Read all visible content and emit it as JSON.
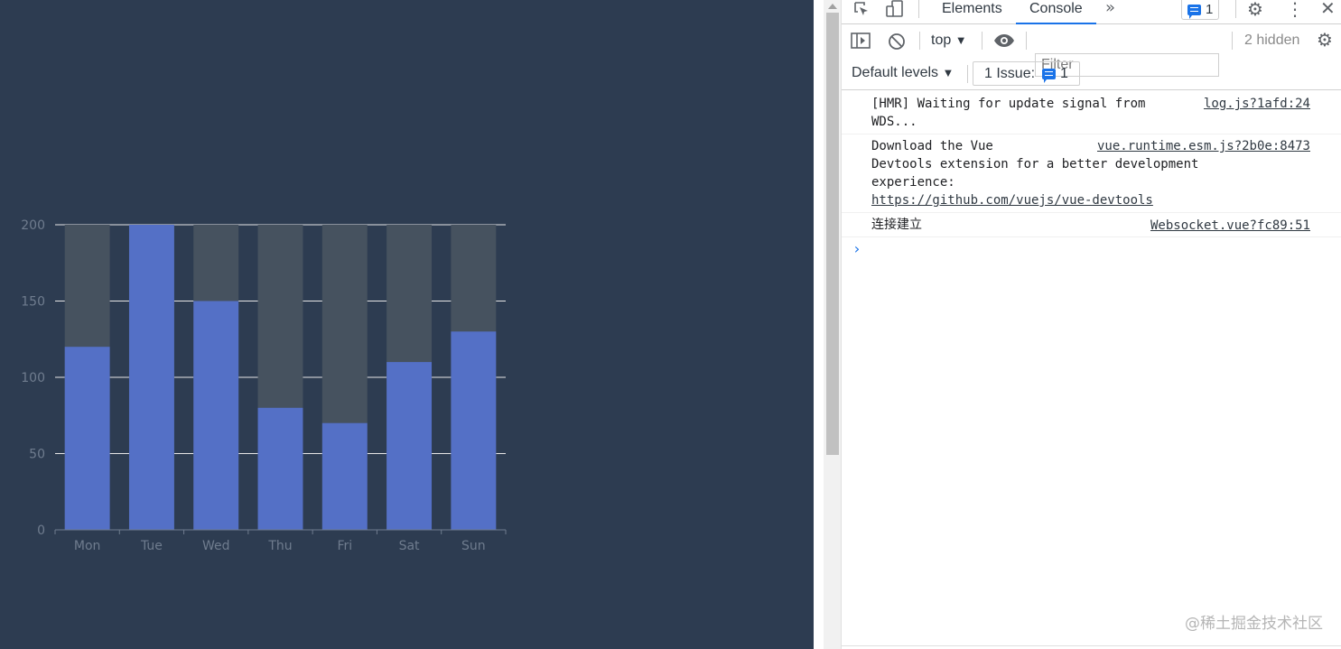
{
  "chart_data": {
    "type": "bar",
    "categories": [
      "Mon",
      "Tue",
      "Wed",
      "Thu",
      "Fri",
      "Sat",
      "Sun"
    ],
    "values": [
      120,
      200,
      150,
      80,
      70,
      110,
      130
    ],
    "background_value": 200,
    "ylim": [
      0,
      200
    ],
    "yticks": [
      0,
      50,
      100,
      150,
      200
    ],
    "grid": true,
    "colors": {
      "bar": "#5470c6",
      "background_bar": "#46525f",
      "grid": "#e6e6e6",
      "axis_label": "#6f7c8e",
      "page_bg": "#2d3c51"
    }
  },
  "devtools": {
    "tabs": {
      "elements": "Elements",
      "console": "Console"
    },
    "issues_badge_count": "1",
    "toolbar": {
      "context": "top",
      "filter_placeholder": "Filter",
      "hidden_count": "2 hidden",
      "levels": "Default levels",
      "issues_label": "1 Issue:",
      "issues_count": "1"
    },
    "messages": [
      {
        "text": "[HMR] Waiting for update signal from\nWDS...",
        "source": "log.js?1afd:24"
      },
      {
        "text": "Download the Vue\nDevtools extension for a better development\nexperience:",
        "link": "https://github.com/vuejs/vue-devtools",
        "source": "vue.runtime.esm.js?2b0e:8473"
      },
      {
        "text": "连接建立",
        "source": "Websocket.vue?fc89:51"
      }
    ],
    "prompt": "›",
    "watermark": "@稀土掘金技术社区"
  },
  "icons": [
    "inspect-icon",
    "device-toggle-icon",
    "more-tabs-icon",
    "settings-icon",
    "kebab-menu-icon",
    "close-icon",
    "sidebar-toggle-icon",
    "clear-console-icon",
    "eye-icon",
    "console-settings-icon",
    "message-icon"
  ]
}
